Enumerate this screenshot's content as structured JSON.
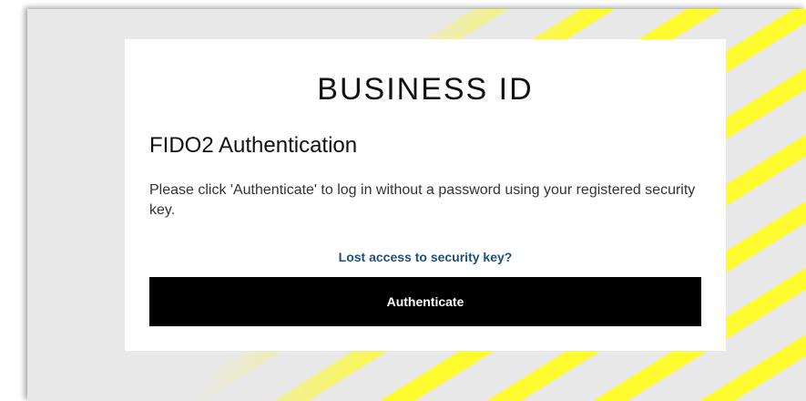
{
  "brand": "BUSINESS ID",
  "heading": "FIDO2 Authentication",
  "description": "Please click 'Authenticate' to log in without a password using your registered security key.",
  "lost_link": "Lost access to security key?",
  "authenticate_button": "Authenticate",
  "colors": {
    "accent_stripe": "#fffb2e",
    "background": "#e8e8e8",
    "button": "#000000",
    "link": "#1f4e79"
  }
}
